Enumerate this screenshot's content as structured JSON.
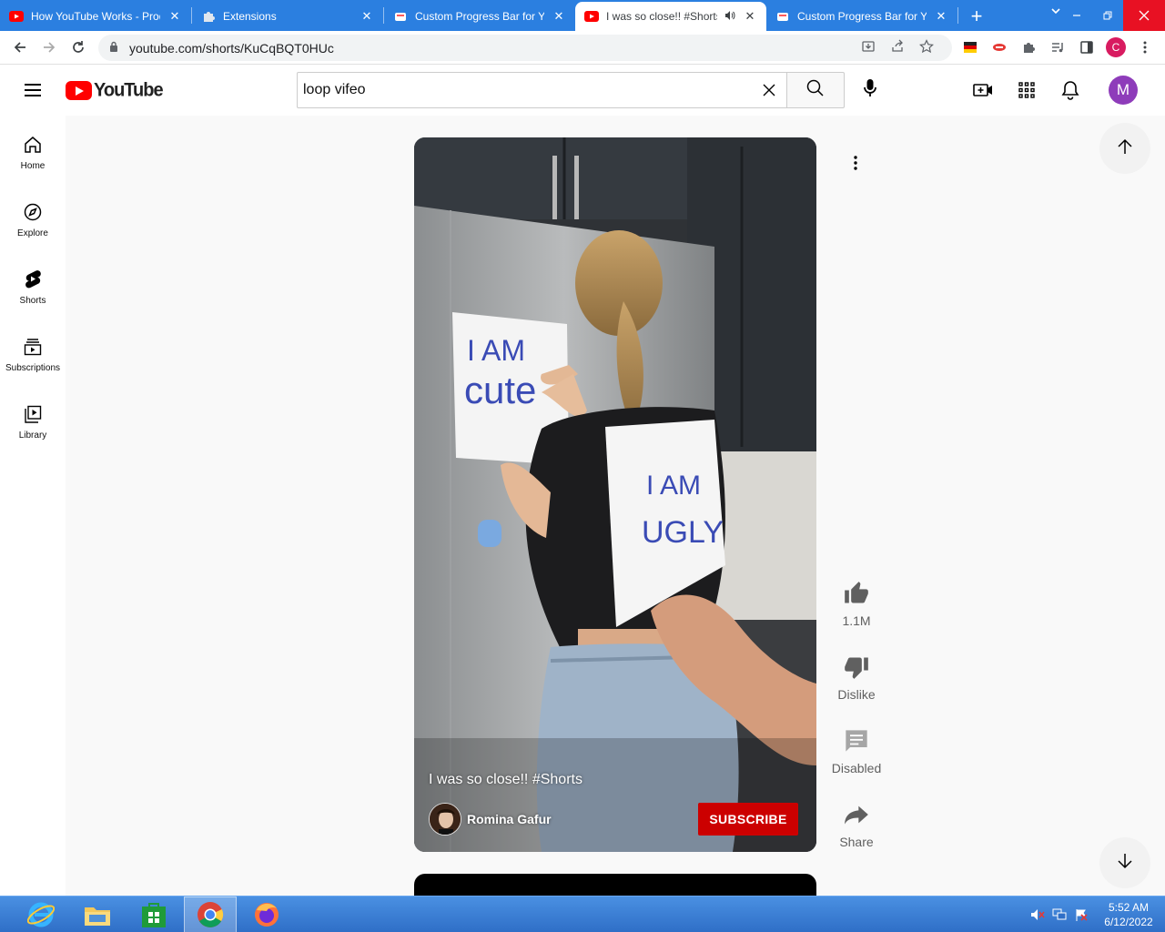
{
  "browser": {
    "tabs": [
      {
        "title": "How YouTube Works - Prod",
        "favicon": "youtube-favicon",
        "active": false
      },
      {
        "title": "Extensions",
        "favicon": "puzzle-icon",
        "active": false
      },
      {
        "title": "Custom Progress Bar for Yo",
        "favicon": "extension-favicon",
        "active": false
      },
      {
        "title": "I was so close!! #Shorts",
        "favicon": "youtube-favicon",
        "active": true,
        "audio": true
      },
      {
        "title": "Custom Progress Bar for Yo",
        "favicon": "extension-favicon",
        "active": false
      }
    ],
    "close_glyph": "✕",
    "newtab_glyph": "+",
    "url": "youtube.com/shorts/KuCqBQT0HUc",
    "profile_letter": "C"
  },
  "masthead": {
    "logo_text": "YouTube",
    "search_value": "loop vifeo",
    "search_placeholder": "Search",
    "avatar_letter": "M"
  },
  "guide": {
    "items": [
      {
        "label": "Home",
        "icon": "home-icon"
      },
      {
        "label": "Explore",
        "icon": "compass-icon"
      },
      {
        "label": "Shorts",
        "icon": "shorts-icon"
      },
      {
        "label": "Subscriptions",
        "icon": "subscriptions-icon"
      },
      {
        "label": "Library",
        "icon": "library-icon"
      }
    ]
  },
  "short": {
    "title": "I was so close!! #Shorts",
    "channel": "Romina Gafur",
    "subscribe_label": "SUBSCRIBE",
    "sign_text_1": "I AM",
    "sign_text_2": "cute",
    "shirt_text_1": "I AM",
    "shirt_text_2": "UGLY"
  },
  "actions": {
    "like_count": "1.1M",
    "dislike_label": "Dislike",
    "comments_label": "Disabled",
    "share_label": "Share"
  },
  "taskbar": {
    "time": "5:52 AM",
    "date": "6/12/2022"
  },
  "colors": {
    "youtube_red": "#ff0000",
    "subscribe_red": "#cc0000",
    "chrome_blue": "#2b7fe0",
    "avatar_purple": "#8e3cba"
  }
}
